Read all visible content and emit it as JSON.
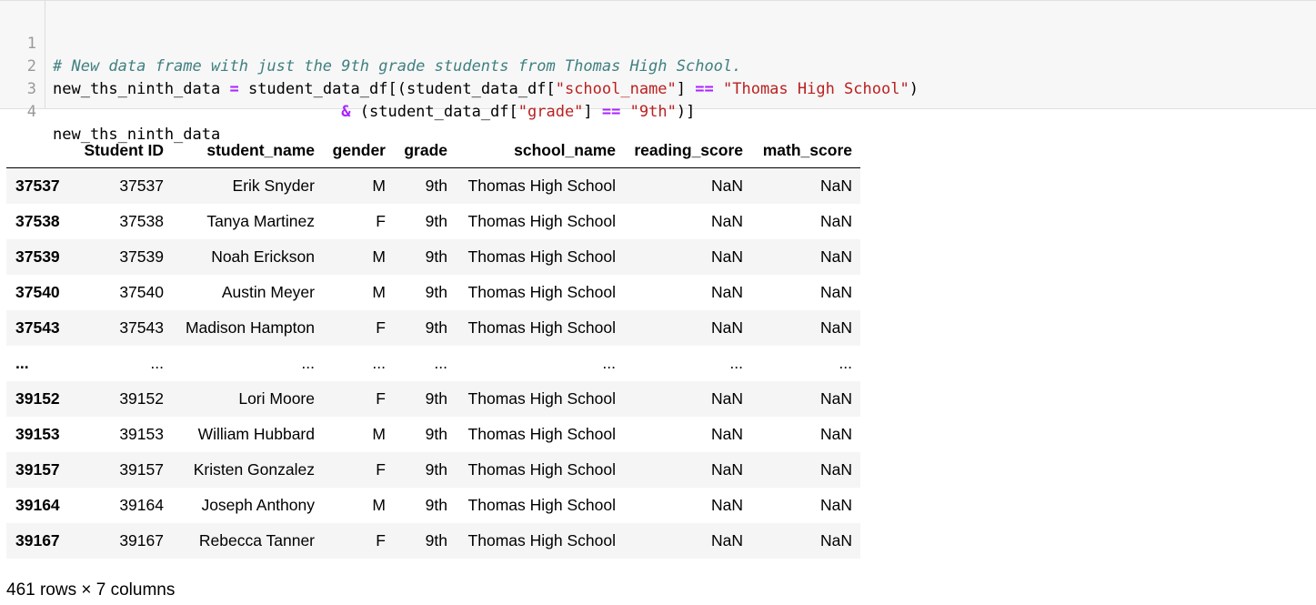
{
  "code": {
    "line_numbers": [
      "1",
      "2",
      "3",
      "4"
    ],
    "line1": {
      "comment": "# New data frame with just the 9th grade students from Thomas High School."
    },
    "line2": {
      "p1": "new_ths_ninth_data ",
      "op1": "=",
      "p2": " student_data_df[(student_data_df[",
      "s1": "\"school_name\"",
      "p3": "] ",
      "op2": "==",
      "p4": " ",
      "s2": "\"Thomas High School\"",
      "p5": ")"
    },
    "line3": {
      "indent": "                               ",
      "op1": "&",
      "p1": " (student_data_df[",
      "s1": "\"grade\"",
      "p2": "] ",
      "op2": "==",
      "p3": " ",
      "s2": "\"9th\"",
      "p4": ")]"
    },
    "line4": {
      "p1": "new_ths_ninth_data"
    }
  },
  "dataframe": {
    "columns": [
      "",
      "Student ID",
      "student_name",
      "gender",
      "grade",
      "school_name",
      "reading_score",
      "math_score"
    ],
    "rows": [
      [
        "37537",
        "37537",
        "Erik Snyder",
        "M",
        "9th",
        "Thomas High School",
        "NaN",
        "NaN"
      ],
      [
        "37538",
        "37538",
        "Tanya Martinez",
        "F",
        "9th",
        "Thomas High School",
        "NaN",
        "NaN"
      ],
      [
        "37539",
        "37539",
        "Noah Erickson",
        "M",
        "9th",
        "Thomas High School",
        "NaN",
        "NaN"
      ],
      [
        "37540",
        "37540",
        "Austin Meyer",
        "M",
        "9th",
        "Thomas High School",
        "NaN",
        "NaN"
      ],
      [
        "37543",
        "37543",
        "Madison Hampton",
        "F",
        "9th",
        "Thomas High School",
        "NaN",
        "NaN"
      ],
      [
        "...",
        "...",
        "...",
        "...",
        "...",
        "...",
        "...",
        "..."
      ],
      [
        "39152",
        "39152",
        "Lori Moore",
        "F",
        "9th",
        "Thomas High School",
        "NaN",
        "NaN"
      ],
      [
        "39153",
        "39153",
        "William Hubbard",
        "M",
        "9th",
        "Thomas High School",
        "NaN",
        "NaN"
      ],
      [
        "39157",
        "39157",
        "Kristen Gonzalez",
        "F",
        "9th",
        "Thomas High School",
        "NaN",
        "NaN"
      ],
      [
        "39164",
        "39164",
        "Joseph Anthony",
        "M",
        "9th",
        "Thomas High School",
        "NaN",
        "NaN"
      ],
      [
        "39167",
        "39167",
        "Rebecca Tanner",
        "F",
        "9th",
        "Thomas High School",
        "NaN",
        "NaN"
      ]
    ],
    "shape": "461 rows × 7 columns"
  }
}
